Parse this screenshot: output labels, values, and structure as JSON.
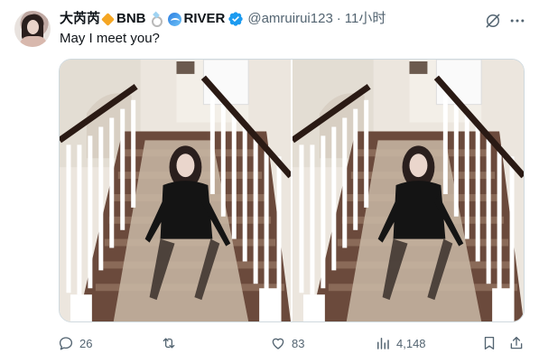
{
  "author": {
    "display_name": "大芮芮",
    "tag_bnb": "BNB",
    "tag_river": "RIVER",
    "handle": "@amruirui123",
    "separator": "·",
    "time": "11小时"
  },
  "tweet": {
    "text": "May I meet you?"
  },
  "actions": {
    "replies": "26",
    "retweets": "",
    "likes": "83",
    "views": "4,148"
  },
  "colors": {
    "verified": "#1d9bf0",
    "diamond": "#f5a623",
    "secondary_text": "#536471"
  },
  "icons": [
    "grok-icon",
    "more-icon",
    "reply-icon",
    "retweet-icon",
    "like-icon",
    "views-icon",
    "bookmark-icon",
    "share-icon"
  ]
}
